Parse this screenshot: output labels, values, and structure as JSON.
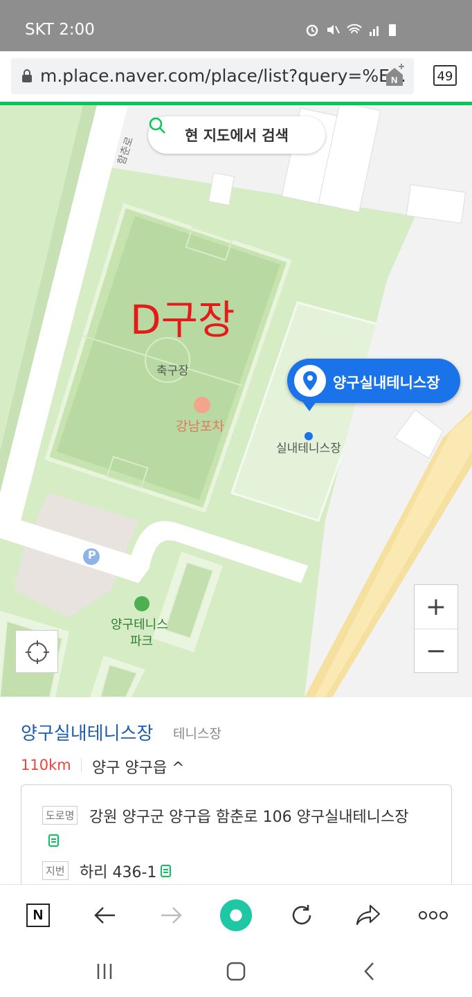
{
  "status_bar": {
    "carrier_time": "SKT 2:00"
  },
  "browser": {
    "url": "m.place.naver.com/place/list?query=%E...",
    "tab_count": "49"
  },
  "map": {
    "search_here_label": "현 지도에서 검색",
    "road_label": "함춘로",
    "field_label": "축구장",
    "restaurant_label": "강남포차",
    "tennis_label": "실내테니스장",
    "park_label_line1": "양구테니스",
    "park_label_line2": "파크",
    "parking_icon_text": "P",
    "selected_pin_label": "양구실내테니스장",
    "annotation": "D구장",
    "zoom_in": "+",
    "zoom_out": "−"
  },
  "place": {
    "name": "양구실내테니스장",
    "category": "테니스장",
    "distance": "110km",
    "region": "양구 양구읍 ^",
    "road_tag": "도로명",
    "road_address": "강원 양구군 양구읍 함춘로 106 양구실내테니스장",
    "lot_tag": "지번",
    "lot_address": "하리 436-1"
  },
  "bottom_nav": {
    "home_letter": "N"
  }
}
